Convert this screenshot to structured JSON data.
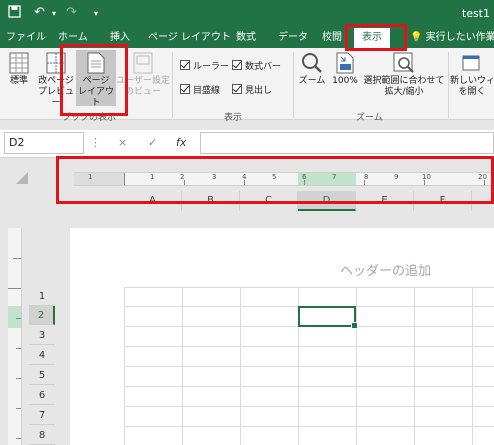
{
  "titlebar": {
    "doc_title": "test1"
  },
  "tabs": [
    "ファイル",
    "ホーム",
    "挿入",
    "ページ レイアウト",
    "数式",
    "データ",
    "校閲",
    "表示"
  ],
  "active_tab": "表示",
  "tell_me": "実行したい作業を入",
  "ribbon": {
    "views": {
      "normal": "標準",
      "page_break_1": "改ページ",
      "page_break_2": "プレビュー",
      "page_layout_1": "ページ",
      "page_layout_2": "レイアウト",
      "custom_1": "ユーザー設定",
      "custom_2": "のビュー",
      "group_label": "ブックの表示"
    },
    "show": {
      "ruler": "ルーラー",
      "formula_bar": "数式バー",
      "gridlines": "目盛線",
      "headings": "見出し",
      "group_label": "表示"
    },
    "zoom": {
      "zoom": "ズーム",
      "hundred": "100%",
      "selection_1": "選択範囲に合わせて",
      "selection_2": "拡大/縮小",
      "group_label": "ズーム"
    },
    "window": {
      "new_window_1": "新しいウィン",
      "new_window_2": "を開く"
    }
  },
  "formula_bar": {
    "name_box": "D2",
    "cancel": "×",
    "enter": "✓",
    "fx": "fx",
    "value": ""
  },
  "ruler_numbers": [
    "1",
    "1",
    "2",
    "3",
    "4",
    "5",
    "6",
    "7",
    "8",
    "9",
    "10",
    "20"
  ],
  "columns": [
    "A",
    "B",
    "C",
    "D",
    "E",
    "F"
  ],
  "selected_column": "D",
  "header_placeholder": "ヘッダーの追加",
  "rows": [
    "1",
    "2",
    "3",
    "4",
    "5",
    "6",
    "7",
    "8"
  ],
  "selected_row": "2",
  "colors": {
    "excel_green": "#217346",
    "highlight_red": "#e0131a"
  }
}
